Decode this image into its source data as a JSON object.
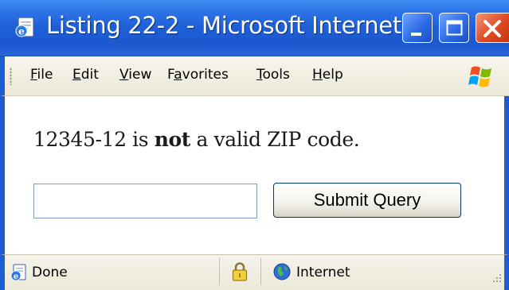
{
  "window": {
    "title": "Listing 22-2 - Microsoft Internet ...",
    "browser_icon": "ie-page-icon",
    "controls": {
      "minimize_icon": "minimize-icon",
      "maximize_icon": "maximize-icon",
      "close_icon": "close-icon"
    },
    "colors": {
      "titlebar": "#1f5fd6",
      "close_button": "#df4a22",
      "chrome": "#ece9d8"
    }
  },
  "menu": {
    "items": [
      {
        "hotkey": "F",
        "rest": "ile"
      },
      {
        "hotkey": "E",
        "rest": "dit"
      },
      {
        "hotkey": "V",
        "rest": "iew"
      },
      {
        "pre": "F",
        "hotkey": "a",
        "rest": "vorites"
      },
      {
        "hotkey": "T",
        "rest": "ools"
      },
      {
        "hotkey": "H",
        "rest": "elp"
      }
    ],
    "logo_icon": "windows-flag-icon"
  },
  "page": {
    "message": {
      "prefix": "12345-12 is ",
      "emphasis": "not",
      "suffix": " a valid ZIP code."
    },
    "zip_input": {
      "value": ""
    },
    "submit_label": "Submit Query"
  },
  "status": {
    "text": "Done",
    "done_icon": "ie-page-icon",
    "lock_icon": "padlock-icon",
    "zone_icon": "globe-icon",
    "zone": "Internet"
  }
}
